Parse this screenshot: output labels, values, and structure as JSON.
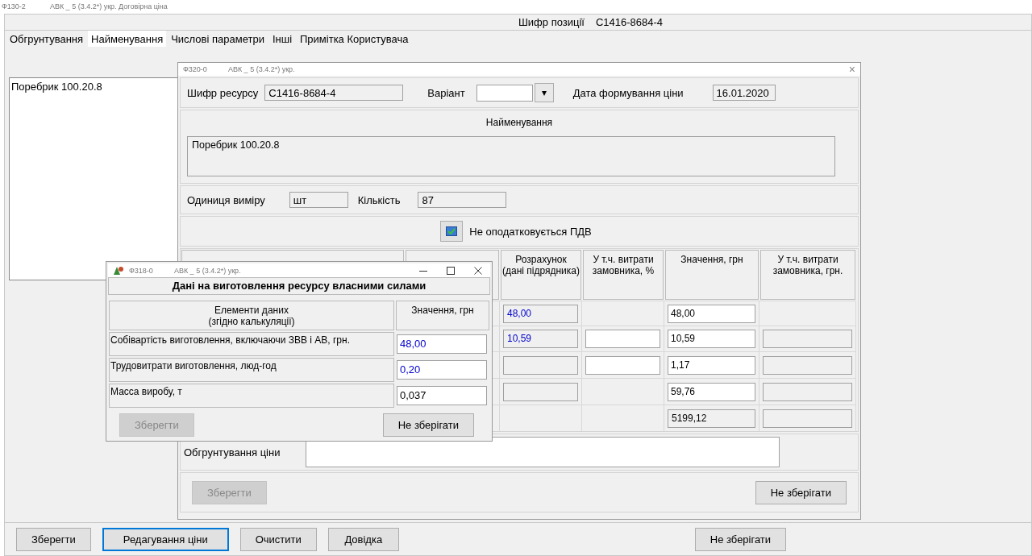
{
  "app_bar": {
    "code": "Ф130-2",
    "title": "АВК _ 5 (3.4.2*) укр. Договірна ціна"
  },
  "header": {
    "label": "Шифр позиції",
    "value": "С1416-8684-4"
  },
  "tabs": [
    {
      "label": "Обгрунтування",
      "selected": false
    },
    {
      "label": "Найменування",
      "selected": true
    },
    {
      "label": "Числові параметри",
      "selected": false
    },
    {
      "label": "Інші",
      "selected": false
    },
    {
      "label": "Примітка Користувача",
      "selected": false
    }
  ],
  "name_list": [
    "Поребрик 100.20.8"
  ],
  "price_window": {
    "code": "Ф320-0",
    "title": "АВК _ 5 (3.4.2*) укр.",
    "close": "×",
    "resource_code_label": "Шифр ресурсу",
    "resource_code": "С1416-8684-4",
    "variant_label": "Варіант",
    "variant_caret": "▾",
    "date_label": "Дата формування ціни",
    "date": "16.01.2020",
    "name_heading": "Найменування",
    "name_text": "Поребрик 100.20.8",
    "unit_label": "Одиниця виміру",
    "unit": "шт",
    "quantity_label": "Кількість",
    "quantity": "87",
    "vat": {
      "label": "Не оподатковується ПДВ",
      "checked": true
    },
    "columns": [
      "Розрахунок\n(дані підрядника)",
      "У т.ч. витрати\nзамовника, %",
      "Значення, грн",
      "У т.ч. витрати\nзамовника, грн."
    ],
    "rows": [
      [
        {
          "kind": "readonly",
          "value": "48,00",
          "color": "#0000cc"
        },
        {
          "kind": "none"
        },
        {
          "kind": "input",
          "value": "48,00",
          "color": "#000000"
        },
        {
          "kind": "none"
        }
      ],
      [
        {
          "kind": "readonly",
          "value": "10,59",
          "color": "#0000cc"
        },
        {
          "kind": "input"
        },
        {
          "kind": "input",
          "value": "10,59",
          "color": "#000000"
        },
        {
          "kind": "readonly"
        }
      ],
      [
        {
          "kind": "readonly"
        },
        {
          "kind": "input"
        },
        {
          "kind": "input",
          "value": "1,17",
          "color": "#000000"
        },
        {
          "kind": "readonly"
        }
      ],
      [
        {
          "kind": "readonly"
        },
        {
          "kind": "none"
        },
        {
          "kind": "input",
          "value": "59,76",
          "color": "#000000"
        },
        {
          "kind": "readonly"
        }
      ],
      [
        {
          "kind": "none"
        },
        {
          "kind": "none"
        },
        {
          "kind": "readonly",
          "value": "5199,12",
          "color": "#000000"
        },
        {
          "kind": "readonly"
        }
      ]
    ],
    "justification_label": "Обгрунтування ціни",
    "buttons": [
      {
        "label": "Зберегти",
        "disabled": true
      },
      {
        "label": "Не зберігати",
        "disabled": false
      }
    ]
  },
  "own_window": {
    "code": "Ф318-0",
    "title": "АВК _ 5 (3.4.2*) укр.",
    "heading": "Дані на виготовлення ресурсу власними силами",
    "columns": [
      "Елементи даних\n(згідно калькуляції)",
      "Значення, грн"
    ],
    "rows": [
      {
        "label": "Собівартість виготовлення, включаючи ЗВВ і АВ, грн.",
        "value": "48,00",
        "color": "#0000cc"
      },
      {
        "label": "Трудовитрати виготовлення, люд-год",
        "value": "0,20",
        "color": "#0000cc"
      },
      {
        "label": "Масса виробу, т",
        "value": "0,037",
        "color": "#000000"
      }
    ],
    "buttons": [
      {
        "label": "Зберегти",
        "disabled": true
      },
      {
        "label": "Не зберігати",
        "disabled": false
      }
    ]
  },
  "bottom_buttons": [
    {
      "label": "Зберегти",
      "focused": false
    },
    {
      "label": "Редагування ціни",
      "focused": true
    },
    {
      "label": "Очистити",
      "focused": false
    },
    {
      "label": "Довідка",
      "focused": false
    },
    {
      "label": "Не зберігати",
      "focused": false
    }
  ]
}
